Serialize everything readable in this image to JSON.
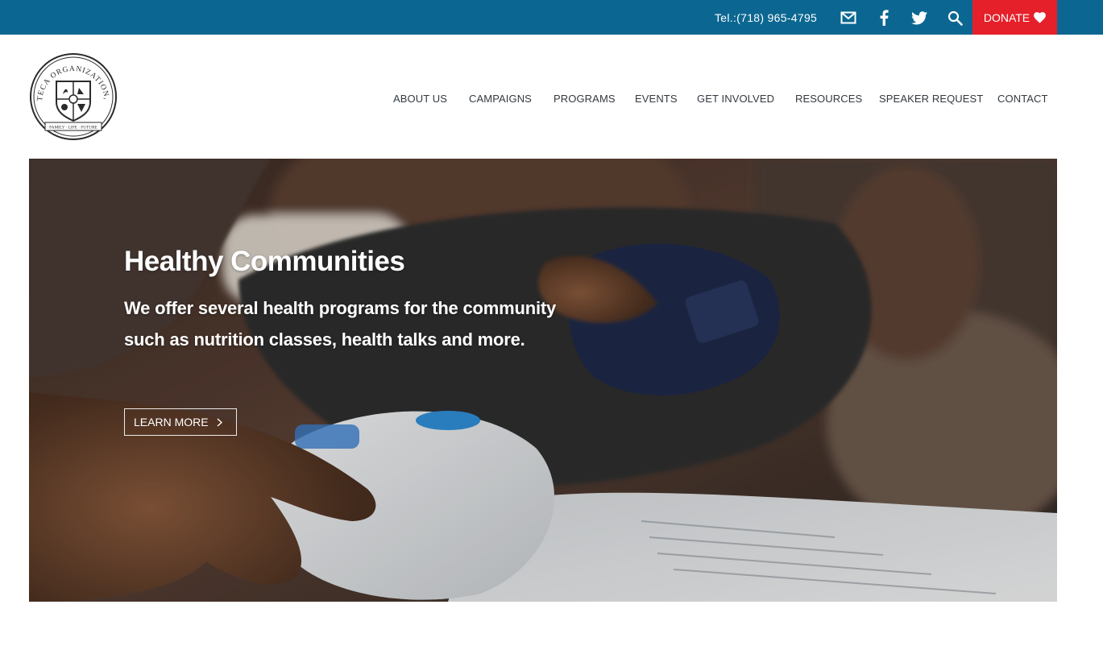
{
  "topbar": {
    "tel": "Tel.:(718) 965-4795",
    "icons": [
      "mail-icon",
      "facebook-icon",
      "twitter-icon",
      "search-icon"
    ],
    "donate_label": "DONATE",
    "bg_color": "#0b6791",
    "donate_color": "#e5202a"
  },
  "logo": {
    "arc_text": "MIXTECA ORGANIZATION, INC",
    "motto": "FAMILY · LIFE · FUTURE"
  },
  "nav": {
    "items": [
      "ABOUT US",
      "CAMPAIGNS",
      "PROGRAMS",
      "EVENTS",
      "GET INVOLVED",
      "RESOURCES",
      "SPEAKER REQUEST",
      "CONTACT"
    ]
  },
  "hero": {
    "title": "Healthy Communities",
    "description": "We offer several health programs for the community such as nutrition classes, health talks and more.",
    "cta_label": "LEARN MORE"
  }
}
